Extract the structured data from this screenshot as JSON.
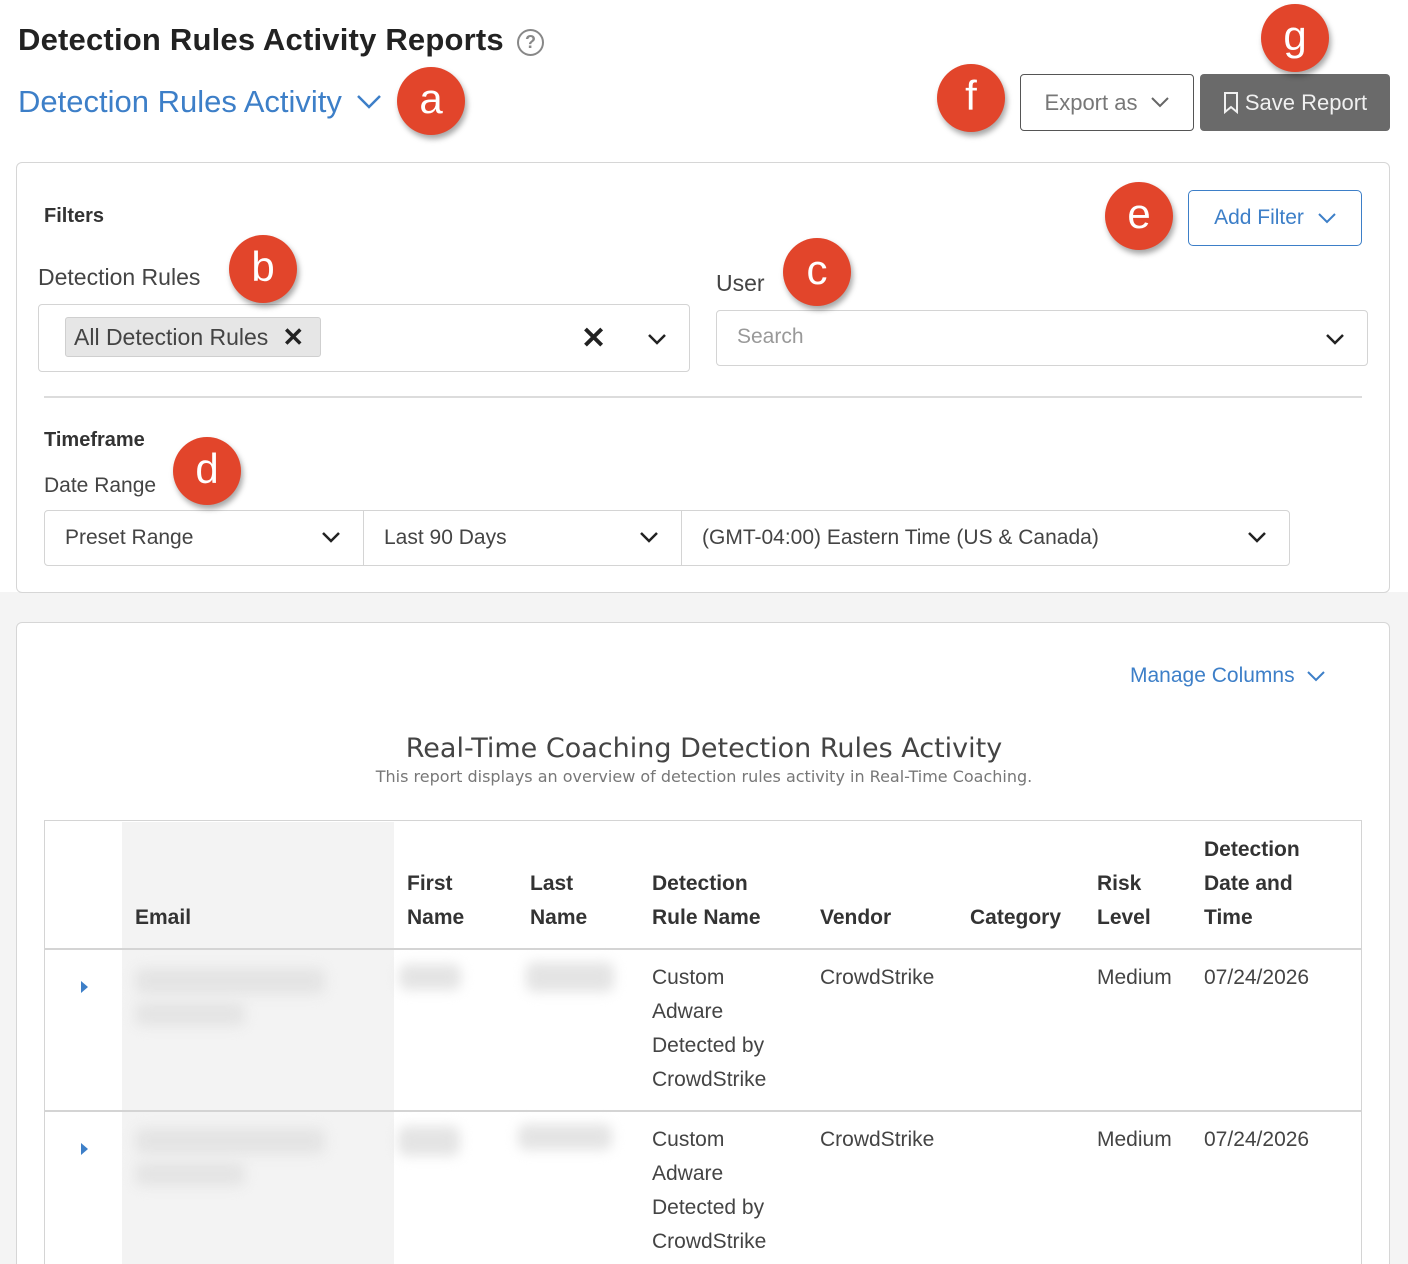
{
  "header": {
    "title": "Detection Rules Activity Reports",
    "help_icon": "?",
    "report_selector": "Detection Rules Activity",
    "export_label": "Export as",
    "save_label": "Save Report"
  },
  "filters": {
    "section_label": "Filters",
    "add_filter_label": "Add Filter",
    "detection_rules": {
      "label": "Detection Rules",
      "chip": "All Detection Rules"
    },
    "user": {
      "label": "User",
      "placeholder": "Search"
    }
  },
  "timeframe": {
    "section_label": "Timeframe",
    "date_range_label": "Date Range",
    "preset": "Preset Range",
    "range": "Last 90 Days",
    "timezone": "(GMT-04:00) Eastern Time (US & Canada)"
  },
  "report": {
    "manage_columns": "Manage Columns",
    "title": "Real-Time Coaching Detection Rules Activity",
    "subtitle": "This report displays an overview of detection rules activity in Real-Time Coaching."
  },
  "table": {
    "columns": {
      "email": "Email",
      "first_name_1": "First",
      "first_name_2": "Name",
      "last_name_1": "Last",
      "last_name_2": "Name",
      "rule_1": "Detection",
      "rule_2": "Rule Name",
      "vendor": "Vendor",
      "category": "Category",
      "risk_1": "Risk",
      "risk_2": "Level",
      "date_1": "Detection",
      "date_2": "Date and",
      "date_3": "Time"
    },
    "rows": [
      {
        "rule_lines": [
          "Custom",
          "Adware",
          "Detected by",
          "CrowdStrike"
        ],
        "vendor": "CrowdStrike",
        "category": "",
        "risk": "Medium",
        "date": "07/24/2026"
      },
      {
        "rule_lines": [
          "Custom",
          "Adware",
          "Detected by",
          "CrowdStrike"
        ],
        "vendor": "CrowdStrike",
        "category": "",
        "risk": "Medium",
        "date": "07/24/2026"
      }
    ]
  },
  "callouts": {
    "a": "a",
    "b": "b",
    "c": "c",
    "d": "d",
    "e": "e",
    "f": "f",
    "g": "g",
    "color": "#e2452b"
  },
  "colors": {
    "link_blue": "#3d7fc8",
    "save_button": "#6a6a6a"
  }
}
